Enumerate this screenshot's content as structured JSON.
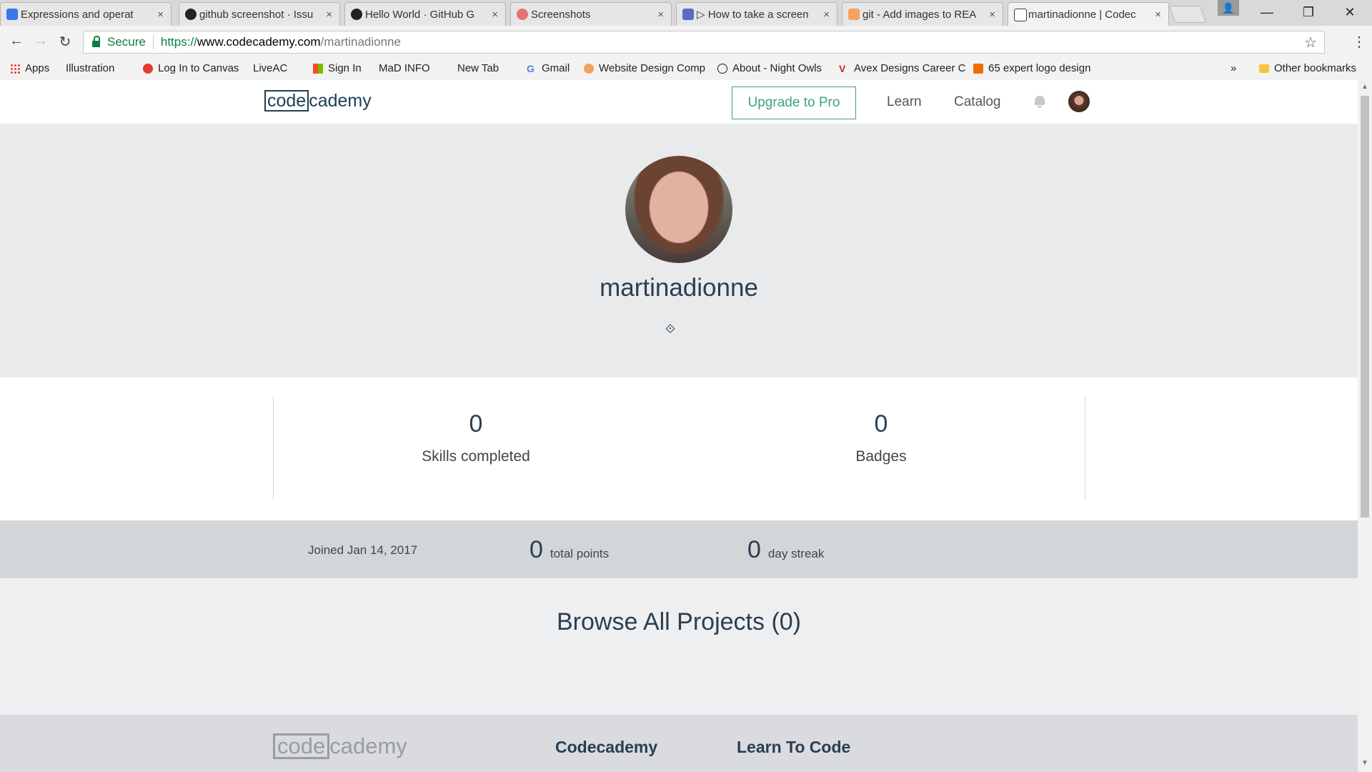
{
  "browser": {
    "tabs": [
      {
        "title": "Expressions and operat",
        "favicon_color": "#3b78e7"
      },
      {
        "title": "github screenshot · Issu",
        "favicon_color": "#222222"
      },
      {
        "title": "Hello World · GitHub G",
        "favicon_color": "#222222"
      },
      {
        "title": "Screenshots",
        "favicon_color": "#e57373"
      },
      {
        "title": "▷ How to take a screen",
        "favicon_color": "#5c6bc0"
      },
      {
        "title": "git - Add images to REA",
        "favicon_color": "#f4a261"
      },
      {
        "title": "martinadionne | Codec",
        "favicon_color": "#1f4056"
      }
    ],
    "tab_close": "×",
    "window_controls": {
      "minimize": "—",
      "maximize": "❐",
      "close": "✕"
    },
    "profile_icon": "👤",
    "secure_label": "Secure",
    "url": {
      "scheme": "https://",
      "host": "www.codecademy.com",
      "path": "/martinadionne"
    },
    "bookmarks": [
      {
        "label": "Apps",
        "icon": "apps-grid-icon"
      },
      {
        "label": "Illustration",
        "icon": "page-icon"
      },
      {
        "label": "Log In to Canvas",
        "icon": "canvas-icon"
      },
      {
        "label": "LiveAC",
        "icon": "page-icon"
      },
      {
        "label": "Sign In",
        "icon": "microsoft-icon"
      },
      {
        "label": "MaD INFO",
        "icon": "page-icon"
      },
      {
        "label": "New Tab",
        "icon": "page-icon"
      },
      {
        "label": "Gmail",
        "icon": "google-icon"
      },
      {
        "label": "Website Design Comp",
        "icon": "site-icon"
      },
      {
        "label": "About - Night Owls",
        "icon": "nightowls-icon"
      },
      {
        "label": "Avex Designs Career C",
        "icon": "avex-icon"
      },
      {
        "label": "65 expert logo design",
        "icon": "cb-icon"
      }
    ],
    "bookmarks_overflow": "»",
    "other_bookmarks": "Other bookmarks"
  },
  "site": {
    "logo_boxed": "code",
    "logo_rest": "cademy",
    "upgrade_label": "Upgrade to Pro",
    "nav": {
      "learn": "Learn",
      "catalog": "Catalog"
    }
  },
  "profile": {
    "username": "martinadionne",
    "expand_glyph": "⟐",
    "skills_completed": "0",
    "skills_label": "Skills completed",
    "badges": "0",
    "badges_label": "Badges",
    "joined": "Joined Jan 14, 2017",
    "total_points": "0",
    "total_points_label": "total points",
    "day_streak": "0",
    "day_streak_label": "day streak"
  },
  "projects": {
    "title": "Browse All Projects (0)"
  },
  "footer": {
    "logo_boxed": "code",
    "logo_rest": "cademy",
    "col1": "Codecademy",
    "col2": "Learn To Code"
  },
  "colors": {
    "accent": "#3fa27d",
    "brand_navy": "#1f4056",
    "secure_green": "#0b8043"
  }
}
